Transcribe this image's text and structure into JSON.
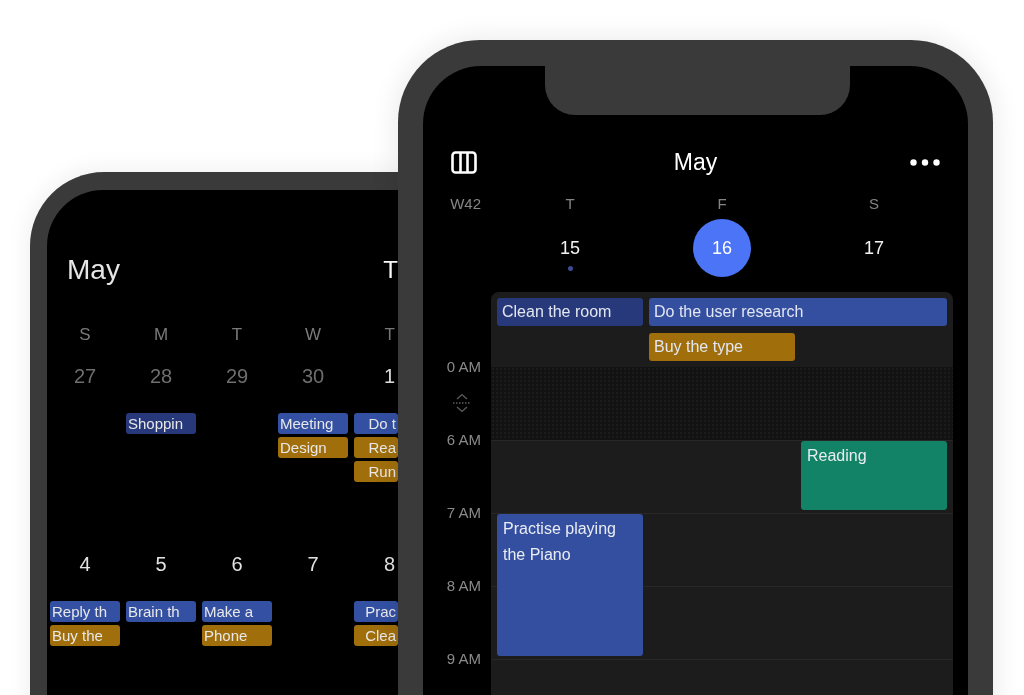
{
  "back_phone": {
    "title": "May",
    "today_button": "T",
    "weekdays": [
      "S",
      "M",
      "T",
      "W",
      "T"
    ],
    "weeks": [
      {
        "days": [
          {
            "date": "27",
            "current_month": false
          },
          {
            "date": "28",
            "current_month": false,
            "events": [
              {
                "title": "Shoppin",
                "color": "#27397a"
              }
            ]
          },
          {
            "date": "29",
            "current_month": false
          },
          {
            "date": "30",
            "current_month": false,
            "events": [
              {
                "title": "Meeting",
                "color": "#3450a3"
              },
              {
                "title": "Design",
                "color": "#a06f0c"
              }
            ]
          },
          {
            "date": "1",
            "current_month": true,
            "events": [
              {
                "title": "Do t",
                "color": "#3450a3"
              },
              {
                "title": "Rea",
                "color": "#a06f0c"
              },
              {
                "title": "Run",
                "color": "#a06f0c"
              }
            ]
          }
        ]
      },
      {
        "days": [
          {
            "date": "4",
            "current_month": true,
            "events": [
              {
                "title": "Reply th",
                "color": "#3450a3"
              },
              {
                "title": "Buy the",
                "color": "#a06f0c"
              }
            ]
          },
          {
            "date": "5",
            "current_month": true,
            "events": [
              {
                "title": "Brain th",
                "color": "#3450a3"
              }
            ]
          },
          {
            "date": "6",
            "current_month": true,
            "events": [
              {
                "title": "Make a",
                "color": "#3450a3"
              },
              {
                "title": "Phone",
                "color": "#a06f0c"
              }
            ]
          },
          {
            "date": "7",
            "current_month": true
          },
          {
            "date": "8",
            "current_month": true,
            "events": [
              {
                "title": "Prac",
                "color": "#3450a3"
              },
              {
                "title": "Clea",
                "color": "#a06f0c"
              }
            ]
          }
        ]
      }
    ]
  },
  "front_phone": {
    "title": "May",
    "week_label": "W42",
    "days": [
      {
        "weekday": "T",
        "date": "15",
        "selected": false,
        "dot": true,
        "all_day": [
          {
            "title": "Clean the room",
            "color": "#27397a",
            "multi_day": false
          }
        ],
        "slots": [
          {
            "kind": "free"
          },
          {
            "kind": "event",
            "title": "Practise playing the Piano",
            "color": "#354fa0"
          },
          {
            "kind": "continued"
          }
        ]
      },
      {
        "weekday": "F",
        "date": "16",
        "selected": true,
        "dot": false,
        "all_day": [
          {
            "title": "Do the user research",
            "color": "#354fa0",
            "multi_day": true
          },
          {
            "title": "Buy the type",
            "color": "#a06f0c",
            "multi_day": false
          }
        ]
      },
      {
        "weekday": "S",
        "date": "17",
        "selected": false,
        "dot": false,
        "slots": [
          {
            "kind": "event",
            "title": "Reading",
            "color": "#128366"
          }
        ]
      }
    ],
    "timeline": {
      "collapsed_label": "0 AM",
      "hours": [
        "6 AM",
        "7 AM",
        "8 AM",
        "9 AM"
      ]
    }
  }
}
